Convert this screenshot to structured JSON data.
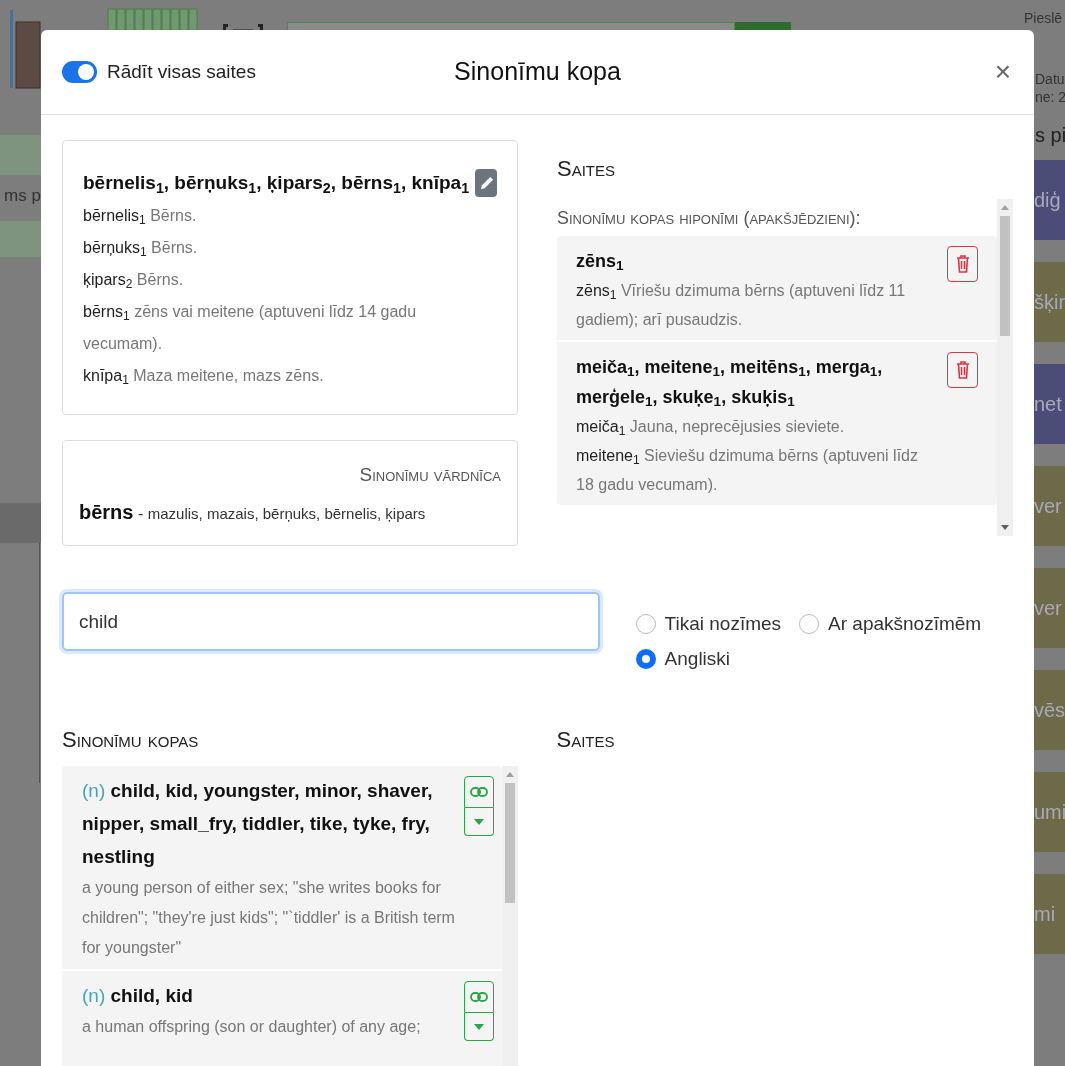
{
  "background": {
    "top_right_text": "Pieslē",
    "info_lines": [
      "Datu",
      "ne: 2"
    ],
    "right_heading": "s pi",
    "left_label": "ms p",
    "side_blocks": [
      {
        "label": "diģ",
        "color": "#4b4c78"
      },
      {
        "label": "šķir",
        "color": "#6c6a48"
      },
      {
        "label": "net",
        "color": "#4b4c78"
      },
      {
        "label": "ver",
        "color": "#6c6a48"
      },
      {
        "label": "ver",
        "color": "#6c6a48"
      },
      {
        "label": "vēs",
        "color": "#6c6a48"
      },
      {
        "label": "umi",
        "color": "#6c6a48"
      },
      {
        "label": "mi",
        "color": "#6c6a48"
      }
    ]
  },
  "dialog": {
    "show_all_links": {
      "label": "Rādīt visas saites",
      "on": true
    },
    "title": "Sinonīmu kopa",
    "close": "×",
    "synset": {
      "words": "bērnelis$_{1}$, bērņuks$_{1}$, ķipars$_{2}$, bērns$_{1}$, knīpa$_{1}$",
      "senses": [
        {
          "term": "bērnelis$_{1}$",
          "text": "Bērns."
        },
        {
          "term": "bērņuks$_{1}$",
          "text": "Bērns."
        },
        {
          "term": "ķipars$_{2}$",
          "text": "Bērns."
        },
        {
          "term": "bērns$_{1}$",
          "text": "zēns vai meitene (aptuveni līdz 14 gadu vecumam)."
        },
        {
          "term": "knīpa$_{1}$",
          "text": "Maza meitene, mazs zēns."
        }
      ]
    },
    "dictionary": {
      "heading": "Sinonīmu vārdnīca",
      "headword": "bērns",
      "dash": "-",
      "synonyms": "mazulis, mazais, bērņuks, bērnelis, ķipars"
    },
    "links": {
      "heading": "Saites",
      "subheading": "Sinonīmu kopas hiponīmi (apakšjēdzieni):",
      "items": [
        {
          "words": "zēns$_{1}$",
          "senses": [
            {
              "term": "zēns$_{1}$",
              "text": "Vīriešu dzimuma bērns (aptuveni līdz 11 gadiem); arī pusaudzis."
            }
          ]
        },
        {
          "words": "meiča$_{1}$, meitene$_{1}$, meitēns$_{1}$, merga$_{1}$, merģele$_{1}$, skuķe$_{1}$, skuķis$_{1}$",
          "senses": [
            {
              "term": "meiča$_{1}$",
              "text": "Jauna, neprecējusies sieviete."
            },
            {
              "term": "meitene$_{1}$",
              "text": "Sieviešu dzimuma bērns (aptuveni līdz 18 gadu vecumam)."
            }
          ]
        }
      ]
    },
    "search": {
      "value": "child"
    },
    "modes": [
      {
        "label": "Tikai nozīmes",
        "selected": false
      },
      {
        "label": "Ar apakšnozīmēm",
        "selected": false
      },
      {
        "label": "Angliski",
        "selected": true
      }
    ],
    "results": {
      "heading": "Sinonīmu kopas",
      "links_heading": "Saites",
      "items": [
        {
          "pos": "(n)",
          "words": "child, kid, youngster, minor, shaver, nipper, small_fry, tiddler, tike, tyke, fry, nestling",
          "gloss": "a young person of either sex; \"she writes books for children\"; \"they're just kids\"; \"`tiddler' is a British term for youngster\""
        },
        {
          "pos": "(n)",
          "words": "child, kid",
          "gloss": "a human offspring (son or daughter) of any age;"
        }
      ]
    }
  }
}
